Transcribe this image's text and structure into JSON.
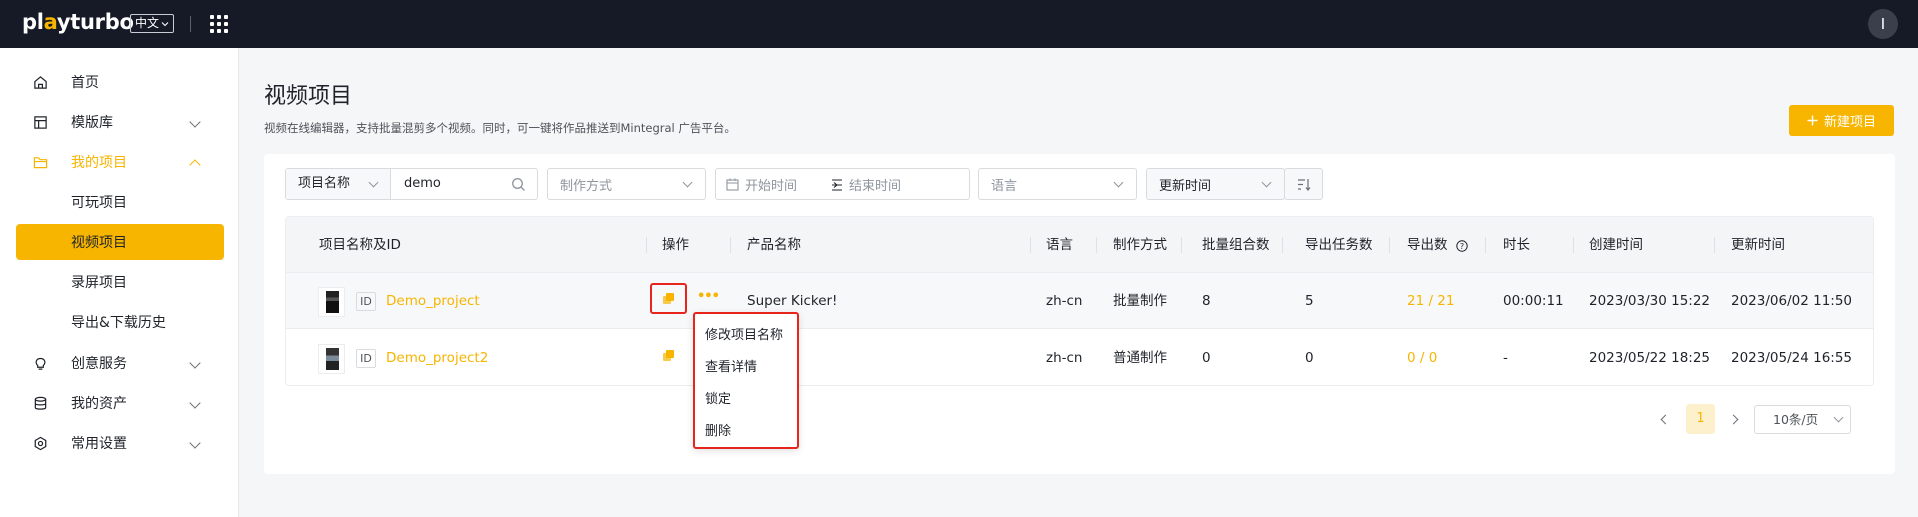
{
  "topbar": {
    "logo_prefix": "pl",
    "logo_o": "a",
    "logo_rest": "yturbo",
    "language": "中文",
    "user_initial": "I"
  },
  "sidebar": {
    "items": [
      {
        "label": "首页",
        "icon": "home-icon"
      },
      {
        "label": "模版库",
        "icon": "template-icon"
      },
      {
        "label": "我的项目",
        "icon": "folder-icon"
      },
      {
        "label": "可玩项目"
      },
      {
        "label": "视频项目"
      },
      {
        "label": "录屏项目"
      },
      {
        "label": "导出&下载历史"
      },
      {
        "label": "创意服务",
        "icon": "lightbulb-icon"
      },
      {
        "label": "我的资产",
        "icon": "database-icon"
      },
      {
        "label": "常用设置",
        "icon": "settings-icon"
      }
    ]
  },
  "main": {
    "title": "视频项目",
    "subtitle": "视频在线编辑器，支持批量混剪多个视频。同时，可一键将作品推送到Mintegral 广告平台。",
    "new_button": "新建项目"
  },
  "filters": {
    "field_select": "项目名称",
    "search_value": "demo",
    "mode_placeholder": "制作方式",
    "start_placeholder": "开始时间",
    "end_placeholder": "结束时间",
    "language_placeholder": "语言",
    "sort_select": "更新时间"
  },
  "table": {
    "headers": [
      "项目名称及ID",
      "操作",
      "产品名称",
      "语言",
      "制作方式",
      "批量组合数",
      "导出任务数",
      "导出数",
      "时长",
      "创建时间",
      "更新时间"
    ],
    "id_tag": "ID",
    "rows": [
      {
        "name": "Demo_project",
        "product": "Super Kicker!",
        "language": "zh-cn",
        "mode": "批量制作",
        "combos": "8",
        "tasks": "5",
        "exports": "21 / 21",
        "duration": "00:00:11",
        "created": "2023/03/30 15:22",
        "updated": "2023/06/02 11:50"
      },
      {
        "name": "Demo_project2",
        "product": "",
        "language": "zh-cn",
        "mode": "普通制作",
        "combos": "0",
        "tasks": "0",
        "exports": "0 / 0",
        "duration": "-",
        "created": "2023/05/22 18:25",
        "updated": "2023/05/24 16:55"
      }
    ]
  },
  "context_menu": {
    "items": [
      "修改项目名称",
      "查看详情",
      "锁定",
      "删除"
    ]
  },
  "pagination": {
    "current_page": "1",
    "page_size": "10条/页"
  },
  "colors": {
    "brand": "#f7b500",
    "topbar": "#161a26",
    "highlight": "#e8251c"
  }
}
